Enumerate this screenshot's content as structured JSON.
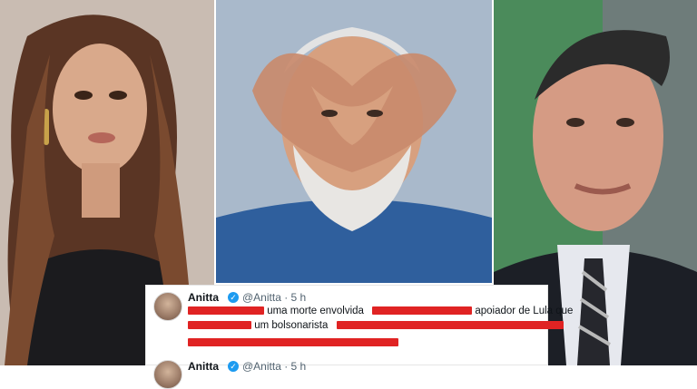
{
  "tweet1": {
    "name": "Anitta",
    "verified_icon": "✓",
    "handle": "@Anitta · 5 h",
    "text_a": "uma morte envolvida",
    "text_b": "apoiador de Lula que",
    "text_c": "um bolsonarista"
  },
  "tweet2": {
    "name": "Anitta",
    "verified_icon": "✓",
    "handle": "@Anitta · 5 h"
  },
  "colors": {
    "redaction": "#e02323",
    "verified": "#1d9bf0"
  }
}
